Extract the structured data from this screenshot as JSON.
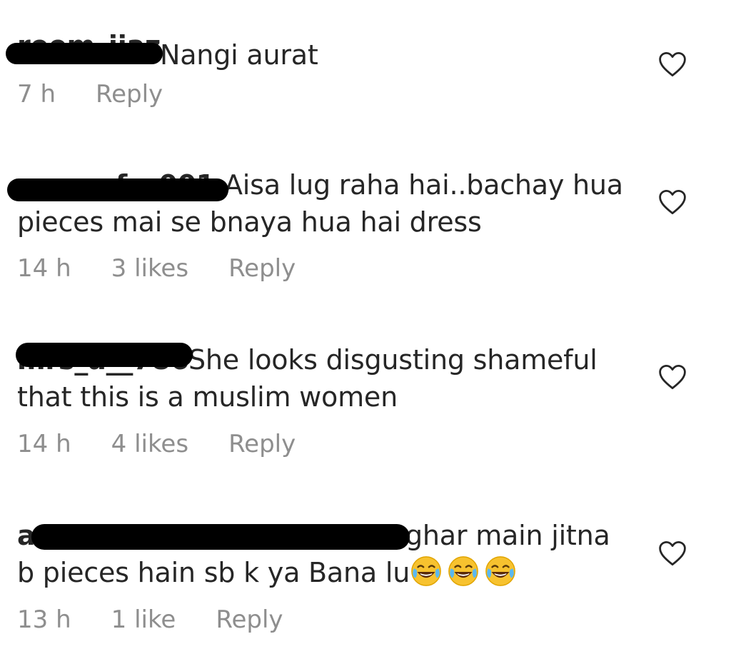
{
  "comments": [
    {
      "username": "reem_ijaz",
      "text": "Nangi aurat",
      "time": "7 h",
      "likes": "",
      "reply": "Reply"
    },
    {
      "username": "sana__fa_001",
      "text": "Aisa lug raha hai..bachay hua pieces mai se bnaya hua hai dress",
      "time": "14 h",
      "likes": "3 likes",
      "reply": "Reply"
    },
    {
      "username": "mrs_a__786",
      "text": "She looks disgusting shameful that this is a muslim women",
      "time": "14 h",
      "likes": "4 likes",
      "reply": "Reply"
    },
    {
      "username": "a",
      "text": "ghar main jitna b pieces hain sb k ya Bana lu",
      "emoji": "face-with-tears-of-joy",
      "emoji_count": 3,
      "time": "13 h",
      "likes": "1 like",
      "reply": "Reply"
    }
  ],
  "icons": {
    "like": "heart-outline-icon"
  },
  "colors": {
    "text": "#262626",
    "meta": "#8e8e8e",
    "redaction": "#000000"
  }
}
